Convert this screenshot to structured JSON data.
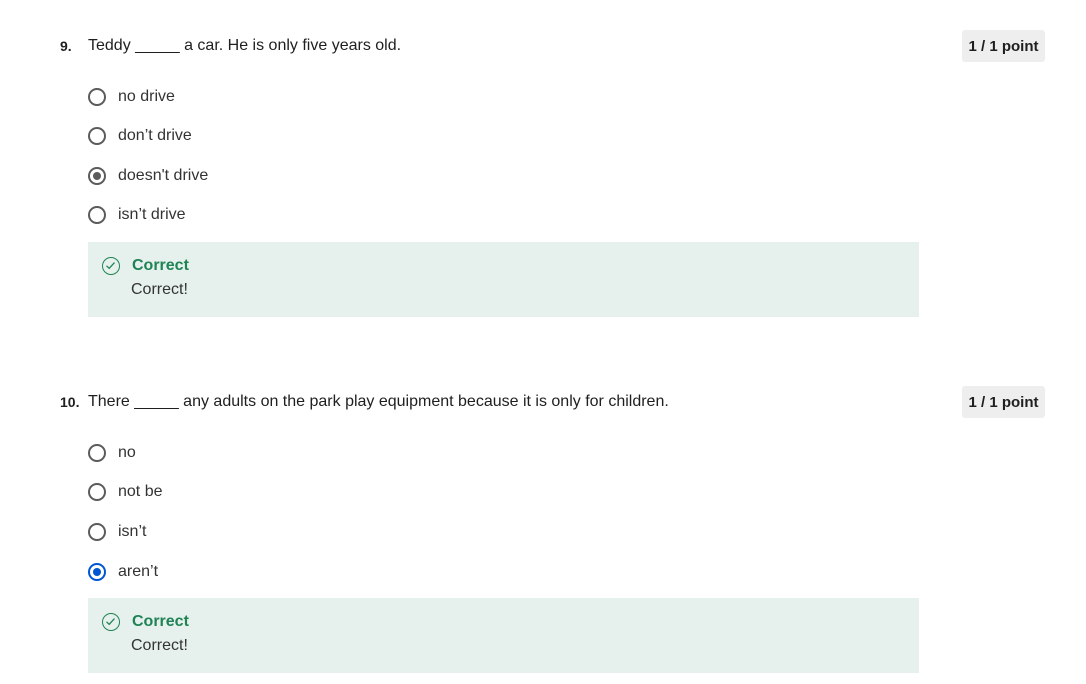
{
  "questions": [
    {
      "number": "9.",
      "text": "Teddy _____ a car.  He is only five years old.",
      "points": "1 / 1 point",
      "options": [
        {
          "label": "no drive",
          "state": "unchecked"
        },
        {
          "label": "don’t drive",
          "state": "unchecked"
        },
        {
          "label": "doesn't drive",
          "state": "checked-gray"
        },
        {
          "label": "isn’t drive",
          "state": "unchecked"
        }
      ],
      "feedback": {
        "title": "Correct",
        "message": "Correct!",
        "icon": "check-circle-icon"
      }
    },
    {
      "number": "10.",
      "text": "There _____ any adults on the park play equipment because it is only for children.",
      "points": "1 / 1 point",
      "options": [
        {
          "label": "no",
          "state": "unchecked"
        },
        {
          "label": "not be",
          "state": "unchecked"
        },
        {
          "label": "isn’t",
          "state": "unchecked"
        },
        {
          "label": "aren’t",
          "state": "checked-blue"
        }
      ],
      "feedback": {
        "title": "Correct",
        "message": "Correct!",
        "icon": "check-circle-icon"
      }
    }
  ],
  "colors": {
    "correct_green": "#1f8354",
    "feedback_bg": "#e6f1ed",
    "selected_blue": "#0056d2"
  }
}
